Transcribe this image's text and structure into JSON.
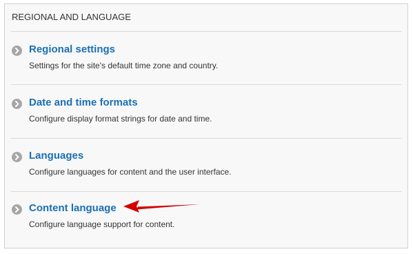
{
  "section": {
    "title": "REGIONAL AND LANGUAGE",
    "items": [
      {
        "title": "Regional settings",
        "description": "Settings for the site's default time zone and country.",
        "icon": "chevron-right-circle-icon"
      },
      {
        "title": "Date and time formats",
        "description": "Configure display format strings for date and time.",
        "icon": "chevron-right-circle-icon"
      },
      {
        "title": "Languages",
        "description": "Configure languages for content and the user interface.",
        "icon": "chevron-right-circle-icon"
      },
      {
        "title": "Content language",
        "description": "Configure language support for content.",
        "icon": "chevron-right-circle-icon"
      }
    ]
  },
  "annotation": {
    "type": "arrow",
    "color": "#e00000",
    "points_to": "Content language"
  },
  "colors": {
    "link": "#1a6fb3",
    "text": "#333333",
    "panel_bg": "#f8f8f8",
    "border": "#cfcfcf",
    "bullet": "#a6a6a6"
  }
}
